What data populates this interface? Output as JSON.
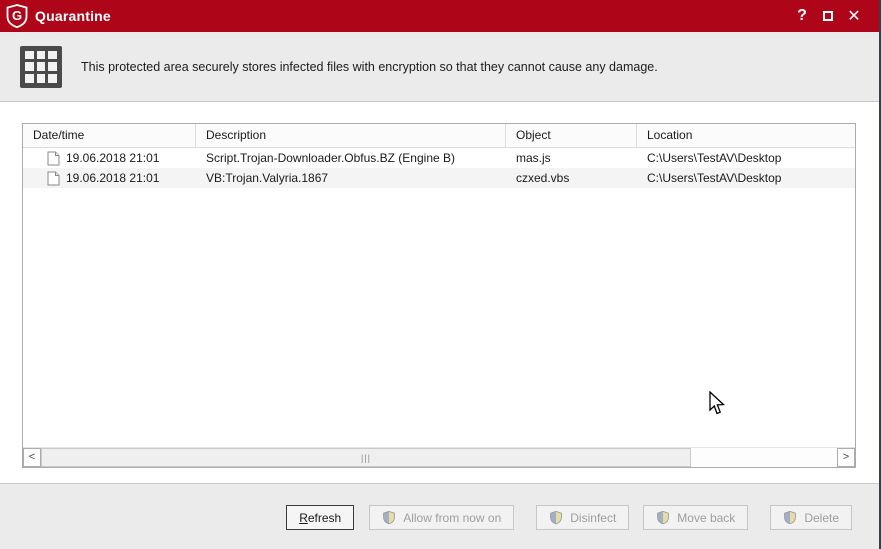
{
  "window": {
    "title": "Quarantine",
    "controls": {
      "help": "?",
      "close": "✕"
    }
  },
  "header": {
    "description": "This protected area securely stores infected files with encryption so that they cannot cause any damage."
  },
  "table": {
    "columns": [
      "Date/time",
      "Description",
      "Object",
      "Location"
    ],
    "rows": [
      {
        "datetime": "19.06.2018 21:01",
        "description": "Script.Trojan-Downloader.Obfus.BZ (Engine B)",
        "object": "mas.js",
        "location": "C:\\Users\\TestAV\\Desktop"
      },
      {
        "datetime": "19.06.2018 21:01",
        "description": "VB:Trojan.Valyria.1867",
        "object": "czxed.vbs",
        "location": "C:\\Users\\TestAV\\Desktop"
      }
    ],
    "scrollbar": {
      "left_arrow": "<",
      "right_arrow": ">",
      "grip": "|||"
    }
  },
  "footer": {
    "buttons": [
      {
        "label_head": "R",
        "label_tail": "efresh",
        "label": "Refresh",
        "enabled": true
      },
      {
        "label": "Allow from now on",
        "enabled": false
      },
      {
        "label": "Disinfect",
        "enabled": false
      },
      {
        "label": "Move back",
        "enabled": false
      },
      {
        "label": "Delete",
        "enabled": false
      }
    ]
  },
  "colors": {
    "titlebar": "#ae0519",
    "panel": "#ebebeb",
    "table_border": "#ababab",
    "disabled_text": "#9e9e9e",
    "shield_blue": "#9fb0c8",
    "shield_yellow": "#e6dca8"
  }
}
